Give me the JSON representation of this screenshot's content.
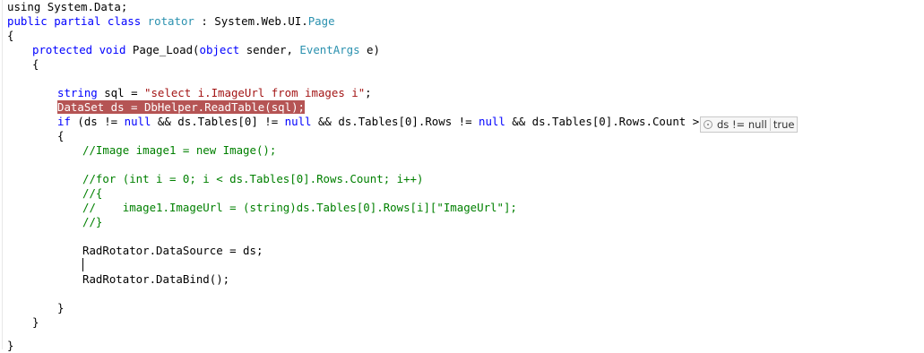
{
  "code": {
    "l1": "using System.Data;",
    "l2_kw": "public partial class",
    "l2_name": "rotator",
    "l2_rest": " : System.Web.UI.",
    "l2_type": "Page",
    "l3": "{",
    "l4_kw": "protected void",
    "l4_mid": " Page_Load(",
    "l4_kw2": "object",
    "l4_mid2": " sender, ",
    "l4_type": "EventArgs",
    "l4_end": " e)",
    "l5": "{",
    "l6_kw": "string",
    "l6_mid": " sql = ",
    "l6_str": "\"select i.ImageUrl from images i\"",
    "l6_end": ";",
    "l7": "DataSet ds = DbHelper.ReadTable(sql);",
    "l8_kw": "if",
    "l8_a": " (ds != ",
    "l8_null1": "null",
    "l8_b": " && ds.Tables[0] != ",
    "l8_null2": "null",
    "l8_c": " && ds.Tables[0].Rows != ",
    "l8_null3": "null",
    "l8_d": " && ds.Tables[0].Rows.Count > 0)",
    "l9": "{",
    "l10": "//Image image1 = new Image();",
    "l11": "//for (int i = 0; i < ds.Tables[0].Rows.Count; i++)",
    "l12": "//{",
    "l13": "//    image1.ImageUrl = (string)ds.Tables[0].Rows[i][\"ImageUrl\"];",
    "l14": "//}",
    "l15": "RadRotator.DataSource = ds;",
    "l16": "RadRotator.DataBind();",
    "l17": "}",
    "l18": "}",
    "l19": "}"
  },
  "datatip": {
    "expression": "ds != null",
    "value": "true",
    "icon": "pin-icon"
  },
  "colors": {
    "keyword": "#0000ff",
    "type": "#2b91af",
    "string": "#a31515",
    "comment": "#008000",
    "breakpoint_highlight": "#b55454"
  }
}
